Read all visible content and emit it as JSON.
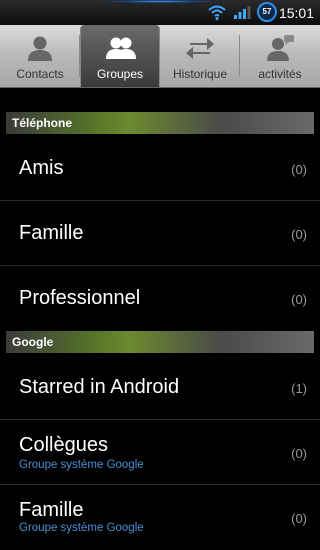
{
  "status_bar": {
    "time": "15:01",
    "battery_level": "57"
  },
  "tabs": [
    {
      "label": "Contacts",
      "icon": "person-icon",
      "active": false
    },
    {
      "label": "Groupes",
      "icon": "group-icon",
      "active": true
    },
    {
      "label": "Historique",
      "icon": "history-arrows-icon",
      "active": false
    },
    {
      "label": "activités",
      "icon": "person-speech-icon",
      "active": false
    }
  ],
  "sections": [
    {
      "title": "Téléphone",
      "groups": [
        {
          "name": "Amis",
          "count": "(0)"
        },
        {
          "name": "Famille",
          "count": "(0)"
        },
        {
          "name": "Professionnel",
          "count": "(0)"
        }
      ]
    },
    {
      "title": "Google",
      "groups": [
        {
          "name": "Starred in Android",
          "count": "(1)"
        },
        {
          "name": "Collègues",
          "subtitle": "Groupe système Google",
          "count": "(0)"
        },
        {
          "name": "Famille",
          "subtitle": "Groupe système Google",
          "count": "(0)"
        }
      ]
    }
  ],
  "colors": {
    "accent_blue": "#4a8fd6",
    "header_green": "#6d8a2e"
  }
}
